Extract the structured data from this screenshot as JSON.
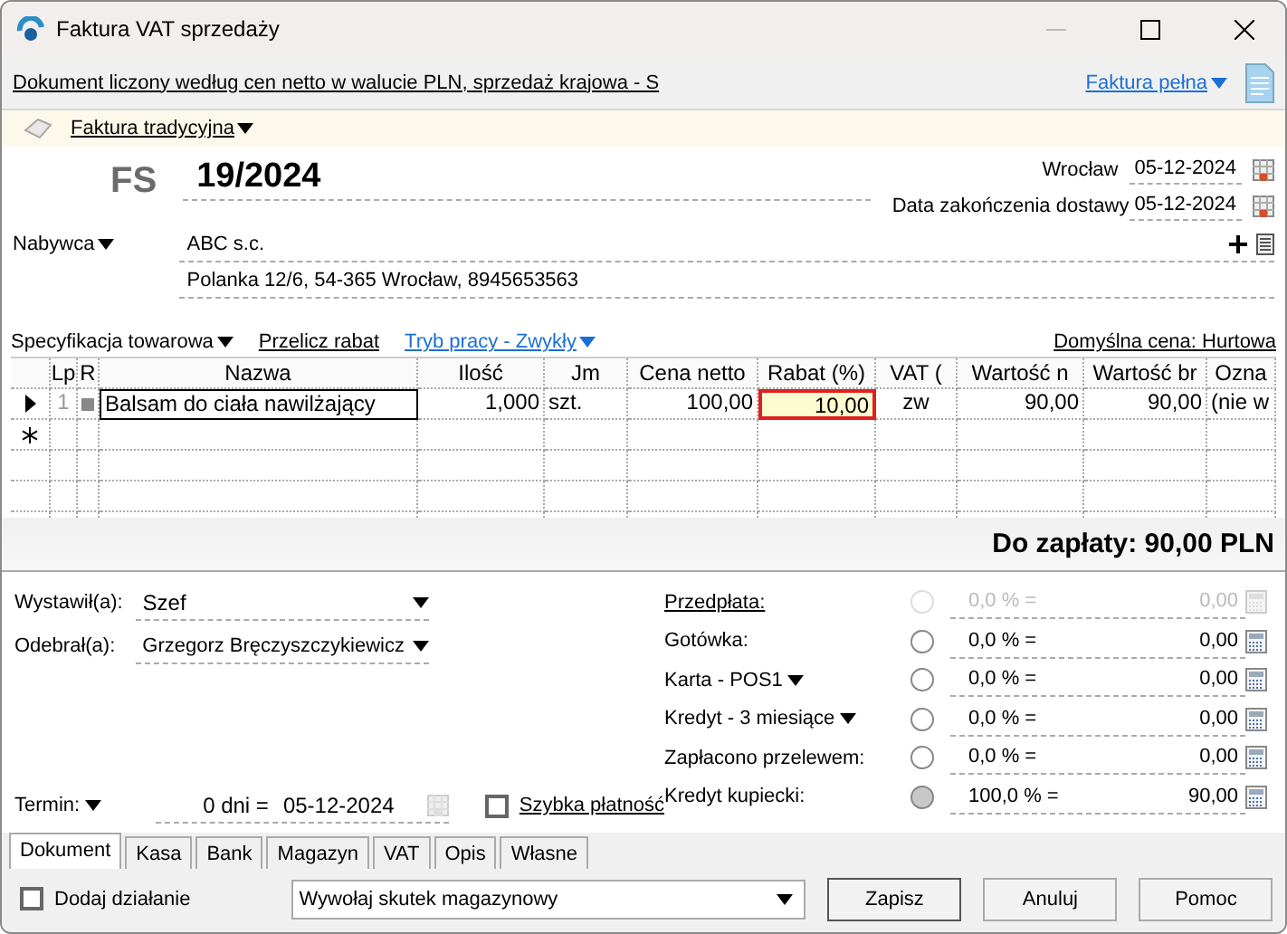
{
  "window": {
    "title": "Faktura VAT sprzedaży"
  },
  "info_bar": {
    "description": "Dokument liczony według cen netto w walucie PLN, sprzedaż krajowa - S",
    "variant": "Faktura pełna"
  },
  "doc_type": "Faktura tradycyjna",
  "header": {
    "prefix": "FS",
    "number": "19/2024",
    "place": "Wrocław",
    "issue_date": "05-12-2024",
    "delivery_label": "Data zakończenia dostawy",
    "delivery_date": "05-12-2024"
  },
  "buyer": {
    "label": "Nabywca",
    "name": "ABC s.c.",
    "address": "Polanka  12/6, 54-365 Wrocław, 8945653563"
  },
  "toolbar": {
    "specification": "Specyfikacja towarowa",
    "recalculate": "Przelicz rabat",
    "mode": "Tryb pracy - Zwykły",
    "default_price": "Domyślna cena: Hurtowa"
  },
  "table": {
    "columns": [
      {
        "label": "Lp"
      },
      {
        "label": "R"
      },
      {
        "label": "Nazwa"
      },
      {
        "label": "Ilość"
      },
      {
        "label": "Jm"
      },
      {
        "label": "Cena netto"
      },
      {
        "label": "Rabat (%)"
      },
      {
        "label": "VAT ("
      },
      {
        "label": "Wartość n"
      },
      {
        "label": "Wartość br"
      },
      {
        "label": "Ozna"
      }
    ],
    "rows": [
      {
        "selected": true,
        "cells": [
          {
            "text": "1",
            "focused": false
          },
          {
            "text": "",
            "focused": false
          },
          {
            "text": "Balsam do ciała nawilżający",
            "focused": false
          },
          {
            "text": "1,000",
            "focused": false
          },
          {
            "text": "szt.",
            "focused": false
          },
          {
            "text": "100,00",
            "focused": false
          },
          {
            "text": "10,00",
            "focused": true
          },
          {
            "text": "zw",
            "focused": false
          },
          {
            "text": "90,00",
            "focused": false
          },
          {
            "text": "90,00",
            "focused": false
          },
          {
            "text": "(nie w",
            "focused": false
          }
        ]
      }
    ]
  },
  "total": "Do zapłaty: 90,00 PLN",
  "issued_by": {
    "label": "Wystawił(a):",
    "value": "Szef"
  },
  "received_by": {
    "label": "Odebrał(a):",
    "value": "Grzegorz Bręczyszczykiewicz"
  },
  "payments": [
    {
      "label": "Przedpłata:",
      "kind": "link",
      "percent": "0,0 % =",
      "amount": "0,00",
      "disabled": true,
      "selected": false
    },
    {
      "label": "Gotówka:",
      "kind": "plain",
      "percent": "0,0 % =",
      "amount": "0,00",
      "disabled": false,
      "selected": false
    },
    {
      "label": "Karta - POS1",
      "kind": "dropdown",
      "percent": "0,0 % =",
      "amount": "0,00",
      "disabled": false,
      "selected": false
    },
    {
      "label": "Kredyt - 3 miesiące",
      "kind": "dropdown",
      "percent": "0,0 % =",
      "amount": "0,00",
      "disabled": false,
      "selected": false
    },
    {
      "label": "Zapłacono przelewem:",
      "kind": "plain",
      "percent": "0,0 % =",
      "amount": "0,00",
      "disabled": false,
      "selected": false
    },
    {
      "label": "Kredyt kupiecki:",
      "kind": "plain",
      "percent": "100,0 % =",
      "amount": "90,00",
      "disabled": false,
      "selected": true
    }
  ],
  "term": {
    "label": "Termin:",
    "days": "0 dni =",
    "date": "05-12-2024"
  },
  "quick_payment": {
    "label": "Szybka płatność",
    "checked": false
  },
  "tabs": [
    {
      "label": "Dokument",
      "selected": true
    },
    {
      "label": "Kasa",
      "selected": false
    },
    {
      "label": "Bank",
      "selected": false
    },
    {
      "label": "Magazyn",
      "selected": false
    },
    {
      "label": "VAT",
      "selected": false
    },
    {
      "label": "Opis",
      "selected": false
    },
    {
      "label": "Własne",
      "selected": false
    }
  ],
  "footer": {
    "add_action": {
      "label": "Dodaj działanie",
      "checked": false
    },
    "warehouse_effect": "Wywołaj skutek magazynowy",
    "buttons": [
      "Zapisz",
      "Anuluj",
      "Pomoc"
    ]
  }
}
